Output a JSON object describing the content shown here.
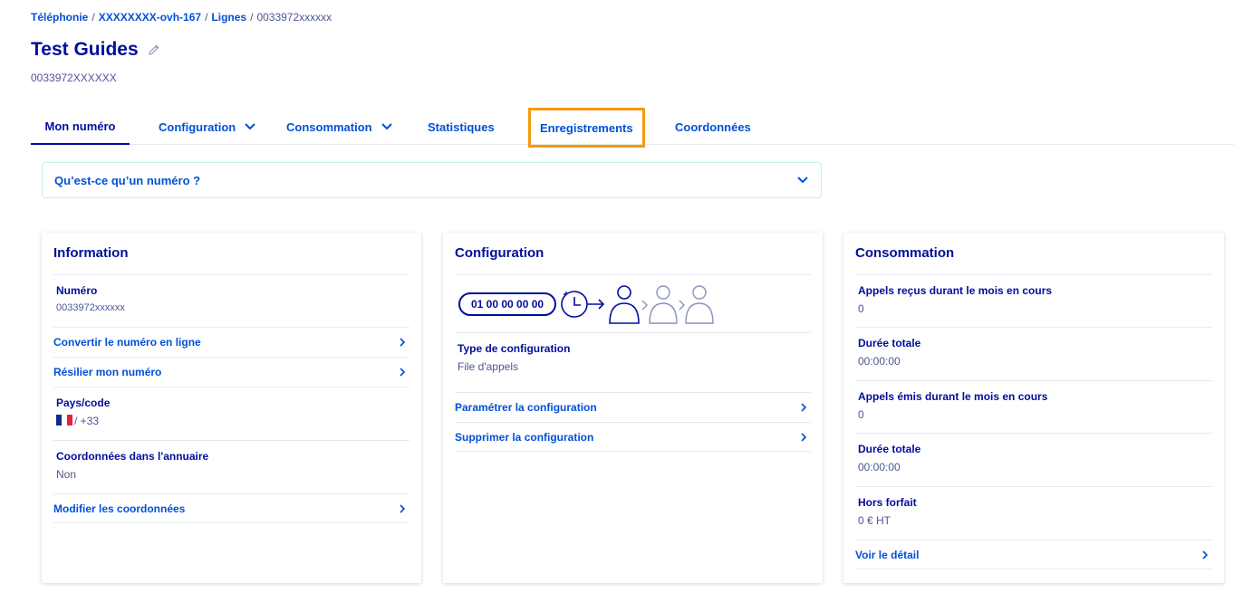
{
  "breadcrumb": {
    "items": [
      "Téléphonie",
      "XXXXXXXX-ovh-167",
      "Lignes"
    ],
    "current": "0033972xxxxxx",
    "separator": "/"
  },
  "title": "Test Guides",
  "subtitle": "0033972XXXXXX",
  "tabs": [
    {
      "label": "Mon numéro",
      "active": true
    },
    {
      "label": "Configuration",
      "dropdown": true
    },
    {
      "label": "Consommation",
      "dropdown": true
    },
    {
      "label": "Statistiques"
    },
    {
      "label": "Enregistrements",
      "highlighted": true
    },
    {
      "label": "Coordonnées"
    }
  ],
  "accordion": {
    "label": "Qu’est-ce qu’un numéro ?"
  },
  "information": {
    "title": "Information",
    "numero_label": "Numéro",
    "numero_value": "0033972xxxxxx",
    "convert_link": "Convertir le numéro en ligne",
    "cancel_link": "Résilier mon numéro",
    "pays_label": "Pays/code",
    "pays_value": "/ +33",
    "annuaire_label": "Coordonnées dans l'annuaire",
    "annuaire_value": "Non",
    "modify_link": "Modifier les coordonnées"
  },
  "configuration": {
    "title": "Configuration",
    "diagram_number": "01 00 00 00 00",
    "type_label": "Type de configuration",
    "type_value": "File d'appels",
    "param_link": "Paramétrer la configuration",
    "delete_link": "Supprimer la configuration"
  },
  "consommation": {
    "title": "Consommation",
    "items": [
      {
        "label": "Appels reçus durant le mois en cours",
        "value": "0"
      },
      {
        "label": "Durée totale",
        "value": "00:00:00"
      },
      {
        "label": "Appels émis durant le mois en cours",
        "value": "0"
      },
      {
        "label": "Durée totale",
        "value": "00:00:00"
      },
      {
        "label": "Hors forfait",
        "value": "0 € HT"
      }
    ],
    "detail_link": "Voir le détail"
  },
  "colors": {
    "primary": "#000e9c",
    "link": "#0050d7",
    "highlight": "#f59a0d",
    "muted": "#4d5693"
  },
  "icons": {
    "edit": "pencil-icon",
    "chevron_down": "chevron-down-icon",
    "chevron_right": "chevron-right-icon",
    "flag": "flag-fr-icon"
  }
}
